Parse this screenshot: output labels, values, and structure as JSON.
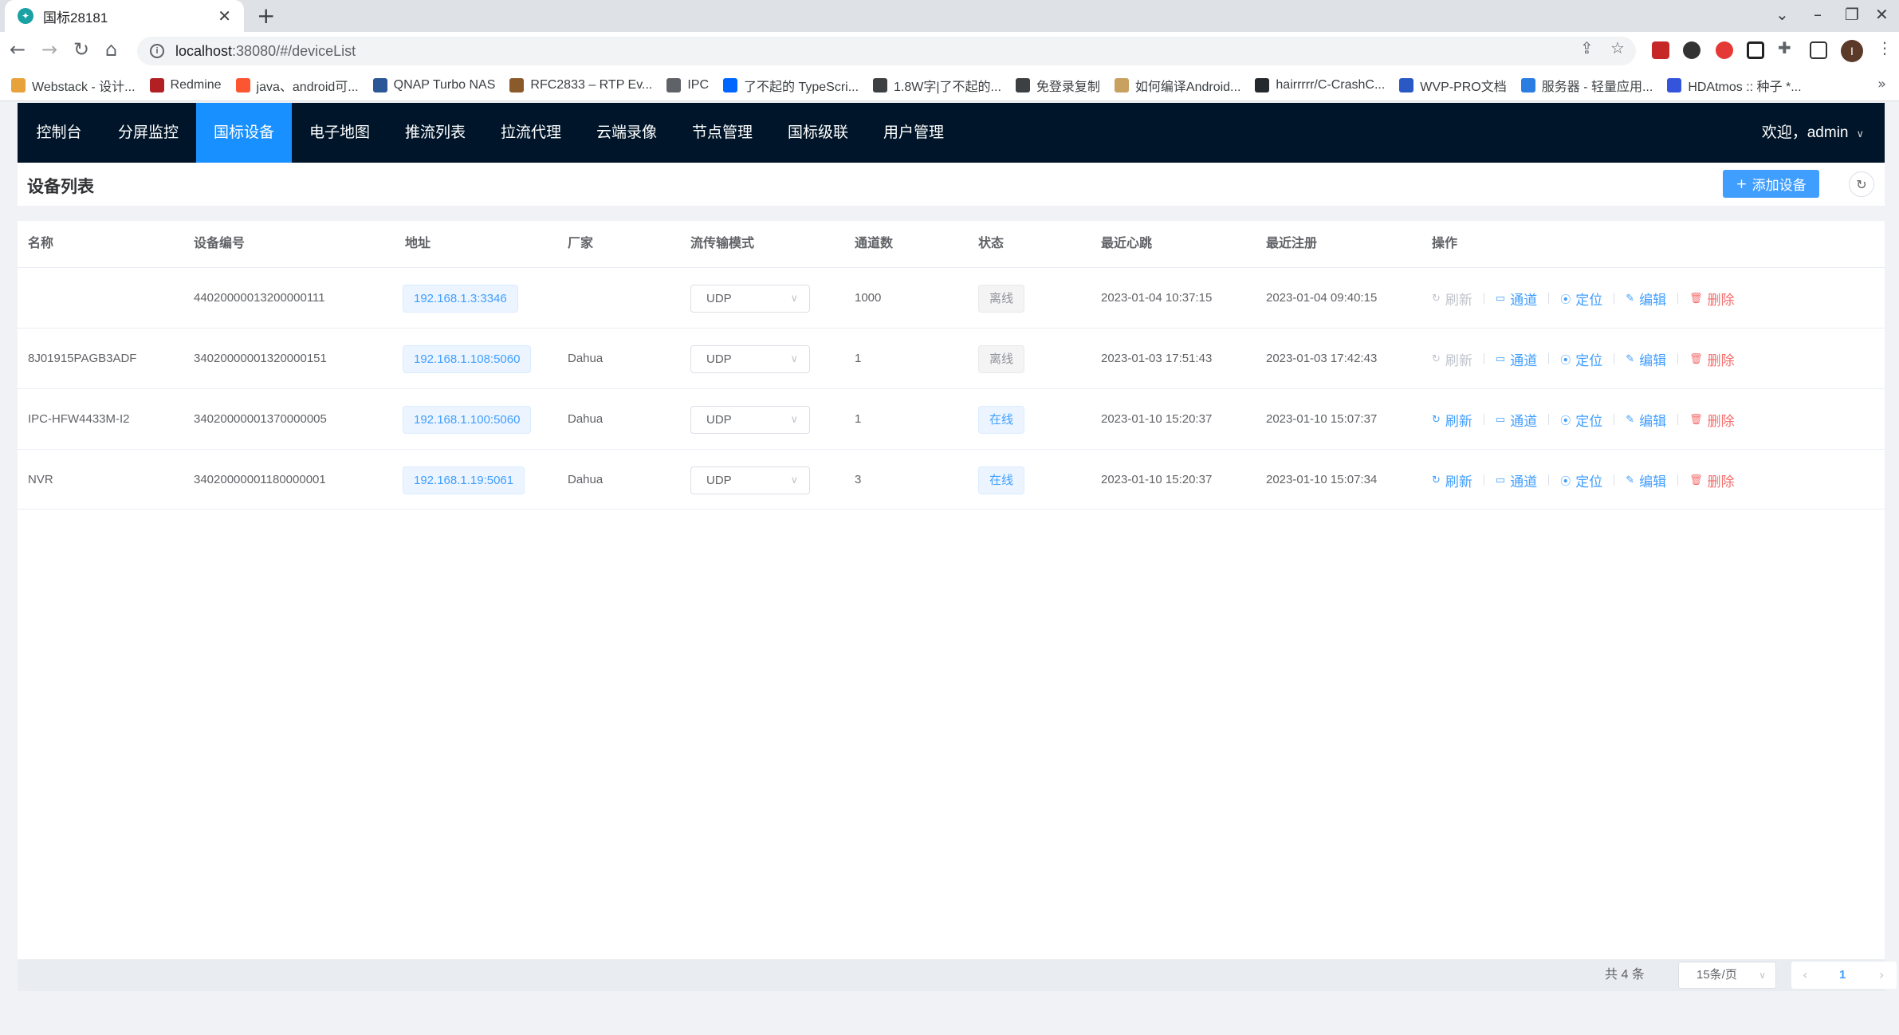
{
  "browser": {
    "tab_title": "国标28181",
    "tab_favicon": "wvp-icon",
    "url_host": "localhost",
    "url_rest": ":38080/#/deviceList",
    "profile_initial": "I",
    "bookmarks": [
      {
        "label": "Webstack - 设计...",
        "icon": "webstack-icon",
        "color": "#e8a23c"
      },
      {
        "label": "Redmine",
        "icon": "redmine-icon",
        "color": "#b32024"
      },
      {
        "label": "java、android可...",
        "icon": "csdn-icon",
        "color": "#fc5531"
      },
      {
        "label": "QNAP Turbo NAS",
        "icon": "qnap-icon",
        "color": "#2b5797"
      },
      {
        "label": "RFC2833 – RTP Ev...",
        "icon": "avatar-icon",
        "color": "#8b5a2b"
      },
      {
        "label": "IPC",
        "icon": "folder-icon",
        "color": "#5f6368"
      },
      {
        "label": "了不起的 TypeScri...",
        "icon": "zhihu-icon",
        "color": "#0066ff"
      },
      {
        "label": "1.8W字|了不起的...",
        "icon": "globe-icon",
        "color": "#3c4043"
      },
      {
        "label": "免登录复制",
        "icon": "globe-icon",
        "color": "#3c4043"
      },
      {
        "label": "如何编译Android...",
        "icon": "avatar-icon",
        "color": "#c8a060"
      },
      {
        "label": "hairrrrr/C-CrashC...",
        "icon": "github-icon",
        "color": "#24292e"
      },
      {
        "label": "WVP-PRO文档",
        "icon": "wvp-icon",
        "color": "#2b59c3"
      },
      {
        "label": "服务器 - 轻量应用...",
        "icon": "cloud-icon",
        "color": "#2a7de1"
      },
      {
        "label": "HDAtmos :: 种子 *...",
        "icon": "hd-icon",
        "color": "#3455db"
      }
    ]
  },
  "nav": {
    "items": [
      "控制台",
      "分屏监控",
      "国标设备",
      "电子地图",
      "推流列表",
      "拉流代理",
      "云端录像",
      "节点管理",
      "国标级联",
      "用户管理"
    ],
    "active": "国标设备",
    "welcome": "欢迎，admin"
  },
  "page": {
    "title": "设备列表",
    "add_button": "添加设备"
  },
  "table": {
    "columns": [
      "名称",
      "设备编号",
      "地址",
      "厂家",
      "流传输模式",
      "通道数",
      "状态",
      "最近心跳",
      "最近注册",
      "操作"
    ],
    "rows": [
      {
        "name": "",
        "device_id": "44020000013200000111",
        "address": "192.168.1.3:3346",
        "vendor": "",
        "transport": "UDP",
        "channels": "1000",
        "status": "离线",
        "online": false,
        "heartbeat": "2023-01-04 10:37:15",
        "register": "2023-01-04 09:40:15"
      },
      {
        "name": "8J01915PAGB3ADF",
        "device_id": "34020000001320000151",
        "address": "192.168.1.108:5060",
        "vendor": "Dahua",
        "transport": "UDP",
        "channels": "1",
        "status": "离线",
        "online": false,
        "heartbeat": "2023-01-03 17:51:43",
        "register": "2023-01-03 17:42:43"
      },
      {
        "name": "IPC-HFW4433M-I2",
        "device_id": "34020000001370000005",
        "address": "192.168.1.100:5060",
        "vendor": "Dahua",
        "transport": "UDP",
        "channels": "1",
        "status": "在线",
        "online": true,
        "heartbeat": "2023-01-10 15:20:37",
        "register": "2023-01-10 15:07:37"
      },
      {
        "name": "NVR",
        "device_id": "34020000001180000001",
        "address": "192.168.1.19:5061",
        "vendor": "Dahua",
        "transport": "UDP",
        "channels": "3",
        "status": "在线",
        "online": true,
        "heartbeat": "2023-01-10 15:20:37",
        "register": "2023-01-10 15:07:34"
      }
    ],
    "actions": {
      "refresh": "刷新",
      "channel": "通道",
      "locate": "定位",
      "edit": "编辑",
      "delete": "删除"
    }
  },
  "pagination": {
    "total_text": "共 4 条",
    "page_size": "15条/页",
    "current_page": "1"
  },
  "colors": {
    "primary": "#409eff",
    "nav_bg": "#001529",
    "nav_active": "#1890ff",
    "danger": "#f56c6c"
  }
}
